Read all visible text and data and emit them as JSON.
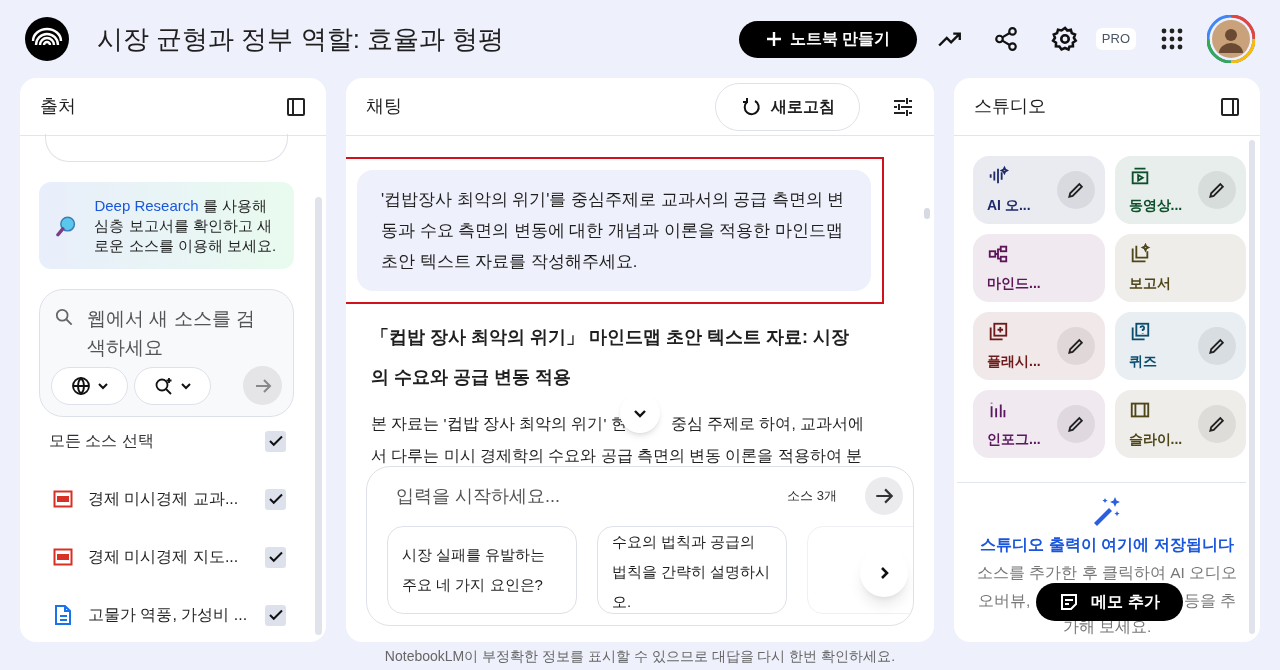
{
  "header": {
    "title": "시장 균형과 정부 역할: 효율과 형평",
    "create_button": "노트북 만들기",
    "pro_badge": "PRO"
  },
  "sources": {
    "title": "출처",
    "promo": {
      "link": "Deep Research",
      "text": " 를 사용해 심층 보고서를 확인하고 새로운 소스를 이용해 보세요."
    },
    "search": {
      "placeholder": "웹에서 새 소스를 검색하세요"
    },
    "select_all": {
      "label": "모든 소스 선택",
      "checked": true
    },
    "items": [
      {
        "kind": "pdf",
        "title": "경제 미시경제 교과...",
        "checked": true
      },
      {
        "kind": "pdf",
        "title": "경제 미시경제 지도...",
        "checked": true
      },
      {
        "kind": "doc",
        "title": "고물가 역풍, 가성비 ...",
        "checked": true
      }
    ]
  },
  "chat": {
    "title": "채팅",
    "refresh_button": "새로고침",
    "user_message": {
      "text": "'컵밥장사 최악의 위기'를 중심주제로 교과서의 공급 측면의 변동과 수요 측면의 변동에 대한 개념과 이론을 적용한 마인드맵 초안 텍스트 자료를 작성해주세요.",
      "highlighted": true
    },
    "response_title": "「컵밥 장사 최악의 위기」 마인드맵 초안 텍스트 자료: 시장의 수요와 공급 변동 적용",
    "response_text": [
      "본 자료는 '컵밥 장사 최악의 위기' 현",
      "중심 주제로 하여, 교과서에",
      "서 다루는 미시 경제학의 수요와 공급 측면의 변동 이론을 적용하여 분"
    ],
    "input": {
      "placeholder": "입력을 시작하세요..."
    },
    "source_count": "소스 3개",
    "suggestions": [
      "시장 실패를 유발하는 주요 네 가지 요인은?",
      "수요의 법칙과 공급의 법칙을 간략히 설명하시오."
    ]
  },
  "studio": {
    "title": "스튜디오",
    "tiles": [
      {
        "kind": "audio",
        "label": "AI 오...",
        "color": "#1f2a6b",
        "editable": true
      },
      {
        "kind": "video",
        "label": "동영상...",
        "color": "#0d4f2b",
        "editable": true
      },
      {
        "kind": "mindmap",
        "label": "마인드...",
        "color": "#5e1659",
        "editable": false
      },
      {
        "kind": "report",
        "label": "보고서",
        "color": "#4e4519",
        "editable": false
      },
      {
        "kind": "flashcard",
        "label": "플래시...",
        "color": "#6e1a1a",
        "editable": true
      },
      {
        "kind": "quiz",
        "label": "퀴즈",
        "color": "#0b4d6e",
        "editable": true
      },
      {
        "kind": "infographic",
        "label": "인포그...",
        "color": "#5b1860",
        "editable": true
      },
      {
        "kind": "slides",
        "label": "슬라이...",
        "color": "#4e4519",
        "editable": true
      }
    ],
    "empty_title": "스튜디오 출력이 여기에 저장됩니다",
    "empty_text": [
      "소스를 추가한 후 클릭하여 AI 오디오",
      "오버뷰,",
      "등을 추",
      "가해 보세요."
    ],
    "memo_button": "메모 추가"
  },
  "footer": "NotebookLM이 부정확한 정보를 표시할 수 있으므로 대답을 다시 한번 확인하세요."
}
